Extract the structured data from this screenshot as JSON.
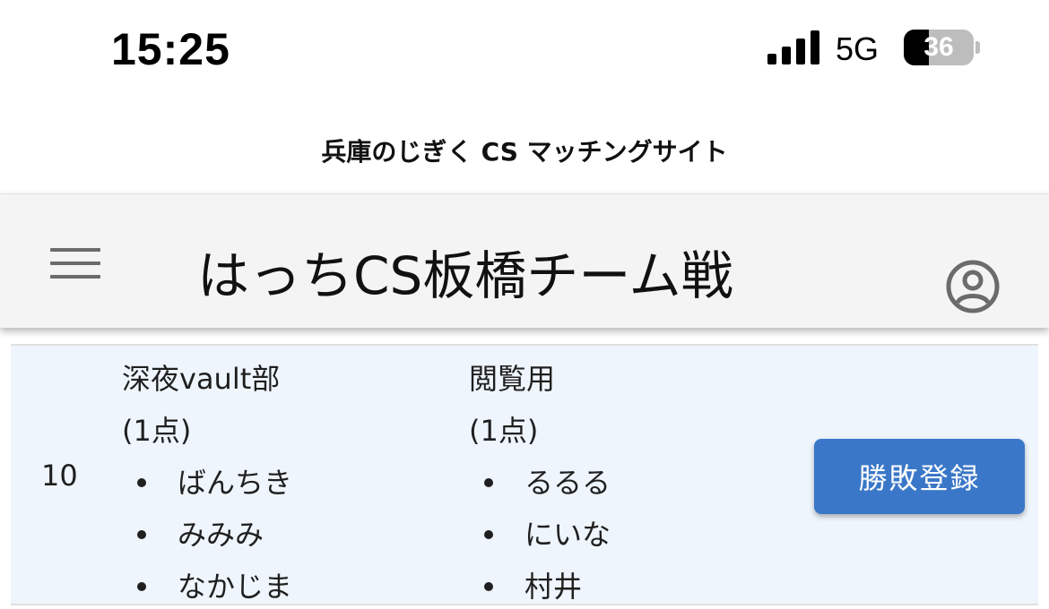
{
  "status_bar": {
    "time": "15:25",
    "network": "5G",
    "battery_level": "36",
    "battery_fraction": 0.36,
    "signal_bars": 4
  },
  "browser": {
    "site_title": "兵庫のじぎく CS マッチングサイト"
  },
  "app_bar": {
    "title": "はっちCS板橋チーム戦",
    "menu_icon": "hamburger-menu-icon",
    "account_icon": "account-circle-icon"
  },
  "match_row": {
    "number": "10",
    "team_a": {
      "name": "深夜vault部",
      "points": "(1点)",
      "members": [
        "ばんちき",
        "みみみ",
        "なかじま"
      ]
    },
    "team_b": {
      "name": "閲覧用",
      "points": "(1点)",
      "members": [
        "るるる",
        "にいな",
        "村井"
      ]
    },
    "button_label": "勝敗登録"
  },
  "colors": {
    "button": "#3a77c8",
    "row_background": "#eef5fc",
    "app_bar_background": "#f4f4f4"
  }
}
